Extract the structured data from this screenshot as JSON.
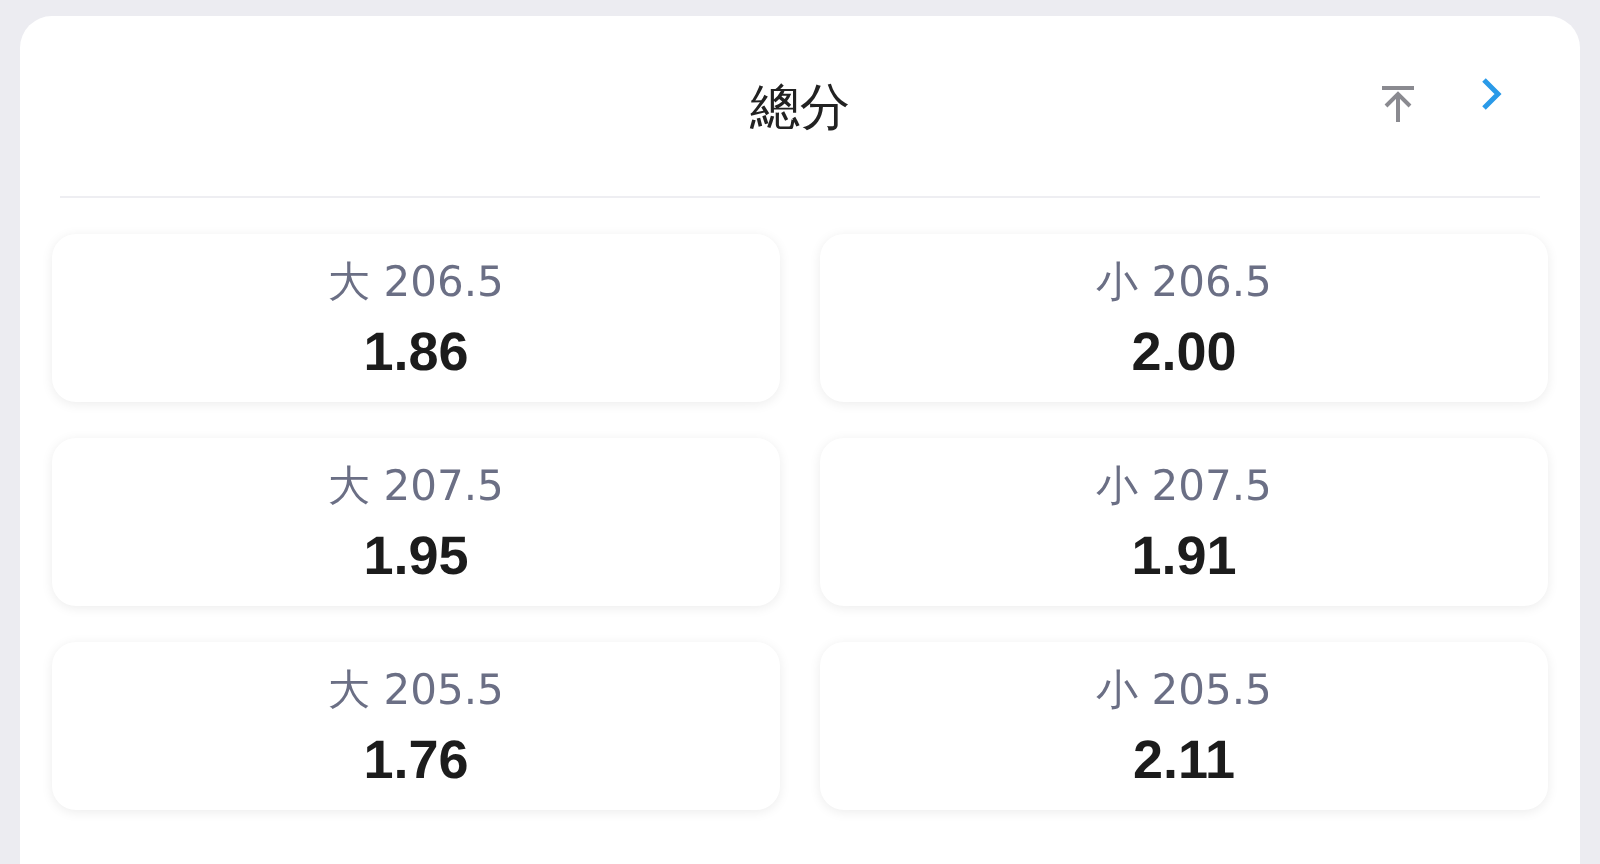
{
  "header": {
    "title": "總分"
  },
  "bets": [
    {
      "label": "大 206.5",
      "odds": "1.86"
    },
    {
      "label": "小 206.5",
      "odds": "2.00"
    },
    {
      "label": "大 207.5",
      "odds": "1.95"
    },
    {
      "label": "小 207.5",
      "odds": "1.91"
    },
    {
      "label": "大 205.5",
      "odds": "1.76"
    },
    {
      "label": "小 205.5",
      "odds": "2.11"
    }
  ]
}
